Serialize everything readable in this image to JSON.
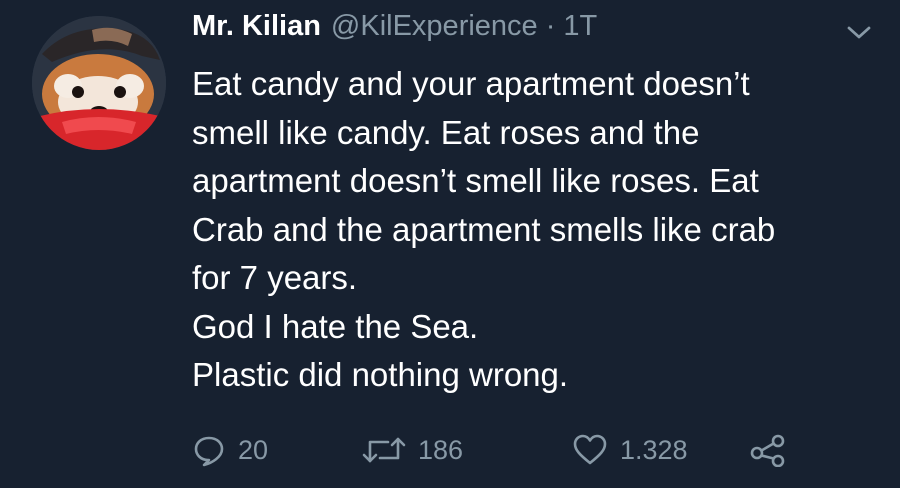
{
  "tweet": {
    "display_name": "Mr. Kilian",
    "handle": "@KilExperience",
    "separator": "·",
    "time": "1T",
    "lines": [
      "Eat candy and your apartment doesn’t",
      "smell like candy. Eat roses and the",
      "apartment doesn’t smell like roses. Eat",
      "Crab and the apartment smells like crab",
      "for 7 years.",
      "God I hate the Sea.",
      "Plastic did nothing wrong."
    ],
    "replies": "20",
    "retweets": "186",
    "likes": "1.328"
  },
  "icons": {
    "menu": "chevron-down-icon",
    "reply": "reply-bubble-icon",
    "retweet": "retweet-icon",
    "like": "heart-icon",
    "share": "share-nodes-icon"
  },
  "colors": {
    "background": "#172130",
    "text": "#ffffff",
    "secondary": "#8899a6"
  }
}
